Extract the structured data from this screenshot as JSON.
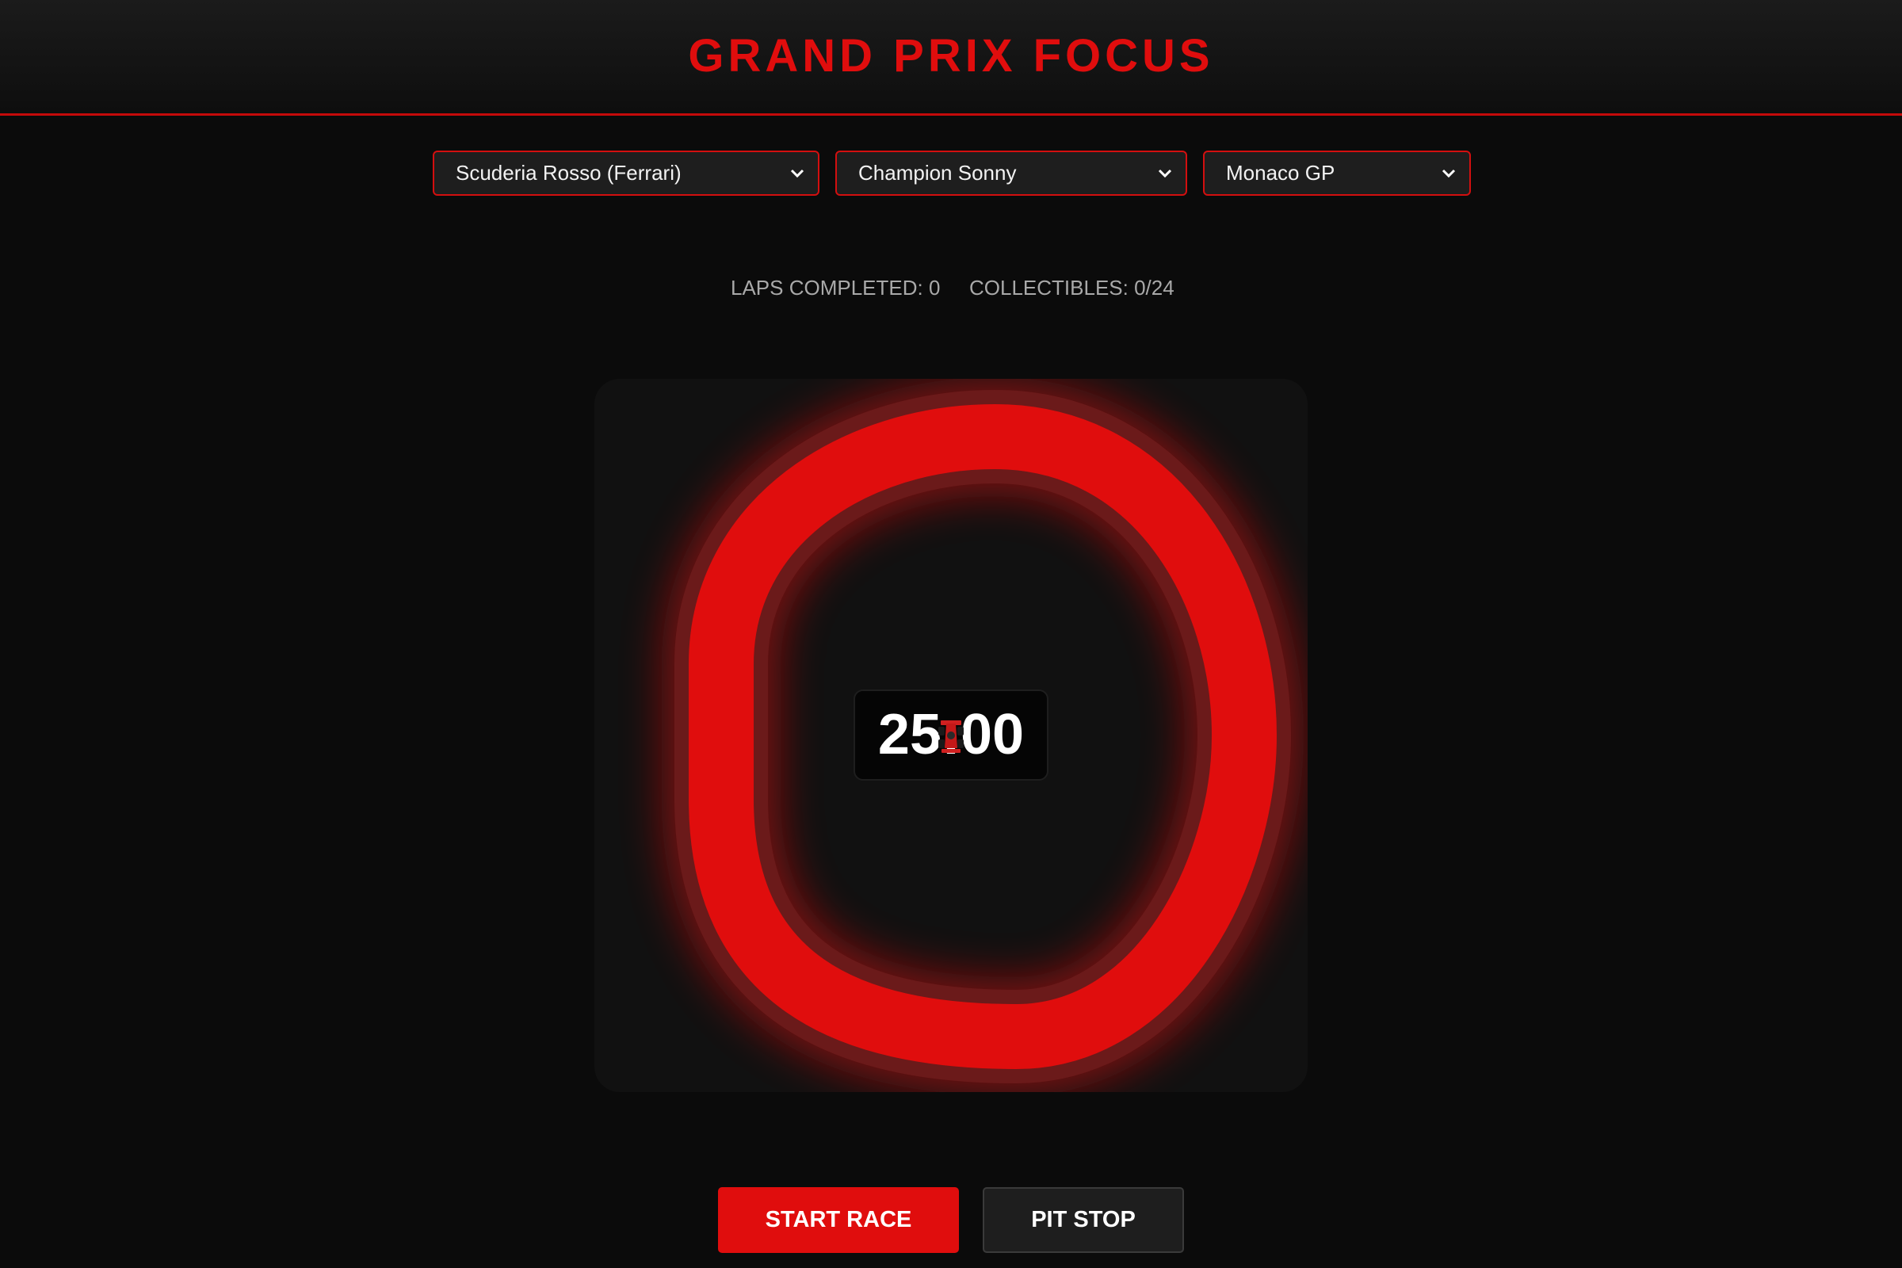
{
  "header": {
    "title": "GRAND PRIX FOCUS"
  },
  "selectors": {
    "team": "Scuderia Rosso (Ferrari)",
    "driver": "Champion Sonny",
    "track": "Monaco GP"
  },
  "stats": {
    "laps": "LAPS COMPLETED: 0",
    "collectibles": "COLLECTIBLES: 0/24"
  },
  "timer": {
    "display": "25:00"
  },
  "buttons": {
    "start": "START RACE",
    "pit": "PIT STOP"
  },
  "colors": {
    "accent": "#e00d0d",
    "track_edge": "#6b1a1a",
    "background": "#0b0b0b",
    "panel": "#111111"
  },
  "icons": {
    "dropdown": "chevron-down-icon",
    "car": "race-car-icon"
  }
}
